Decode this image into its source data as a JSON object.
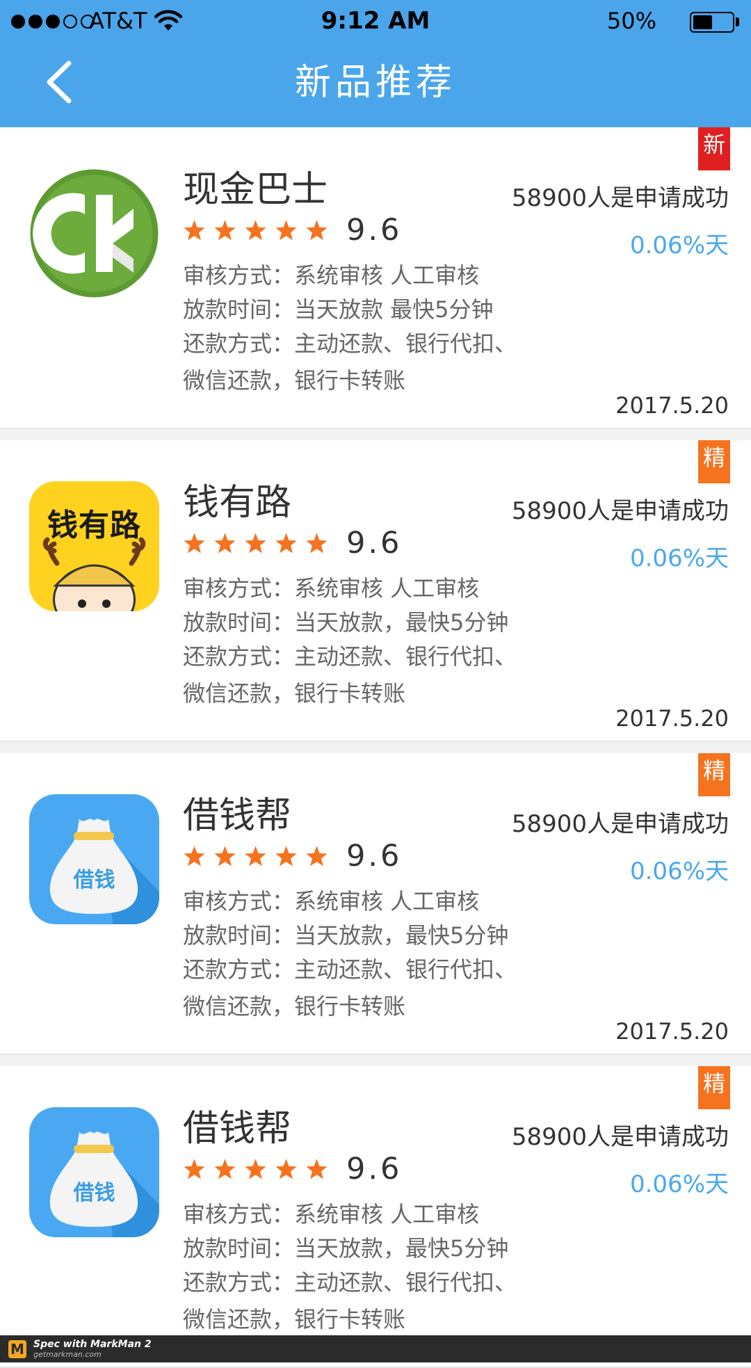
{
  "status_bar": {
    "carrier": "AT&T",
    "time": "9:12 AM",
    "battery": "50%",
    "battery_level": 0.5
  },
  "nav": {
    "title": "新品推荐",
    "back_icon": "chevron-left-icon"
  },
  "colors": {
    "header_bg": "#4aa5ea",
    "text_dark": "#333333",
    "text_gray": "#666666",
    "rate_blue": "#49a8ef",
    "star_orange": "#f5731f",
    "badge_red": "#e02020",
    "badge_orange": "#f5731f"
  },
  "apps": [
    {
      "name": "现金巴士",
      "rating": "9.6",
      "stars": 5,
      "badge": "新",
      "review": "审核方式：系统审核  人工审核",
      "payout": "放款时间：当天放款  最快5分钟",
      "repay1": "还款方式：主动还款、银行代扣、",
      "repay2": "微信还款，银行卡转账",
      "applicants": "58900人是申请成功",
      "rate": "0.06%天",
      "date": "2017.5.20"
    },
    {
      "name": "钱有路",
      "rating": "9.6",
      "stars": 5,
      "badge": "精",
      "icon_text": "钱有路",
      "review": "审核方式：系统审核  人工审核",
      "payout": "放款时间：当天放款，最快5分钟",
      "repay1": "还款方式：主动还款、银行代扣、",
      "repay2": "微信还款，银行卡转账",
      "applicants": "58900人是申请成功",
      "rate": "0.06%天",
      "date": "2017.5.20"
    },
    {
      "name": "借钱帮",
      "rating": "9.6",
      "stars": 5,
      "badge": "精",
      "icon_text": "借钱",
      "review": "审核方式：系统审核  人工审核",
      "payout": "放款时间：当天放款，最快5分钟",
      "repay1": "还款方式：主动还款、银行代扣、",
      "repay2": "微信还款，银行卡转账",
      "applicants": "58900人是申请成功",
      "rate": "0.06%天",
      "date": "2017.5.20"
    },
    {
      "name": "借钱帮",
      "rating": "9.6",
      "stars": 5,
      "badge": "精",
      "icon_text": "借钱",
      "review": "审核方式：系统审核  人工审核",
      "payout": "放款时间：当天放款，最快5分钟",
      "repay1": "还款方式：主动还款、银行代扣、",
      "repay2": "微信还款，银行卡转账",
      "applicants": "58900人是申请成功",
      "rate": "0.06%天",
      "date": ""
    }
  ],
  "footer": {
    "line1": "Spec with MarkMan 2",
    "line2": "getmarkman.com",
    "logo": "M"
  }
}
